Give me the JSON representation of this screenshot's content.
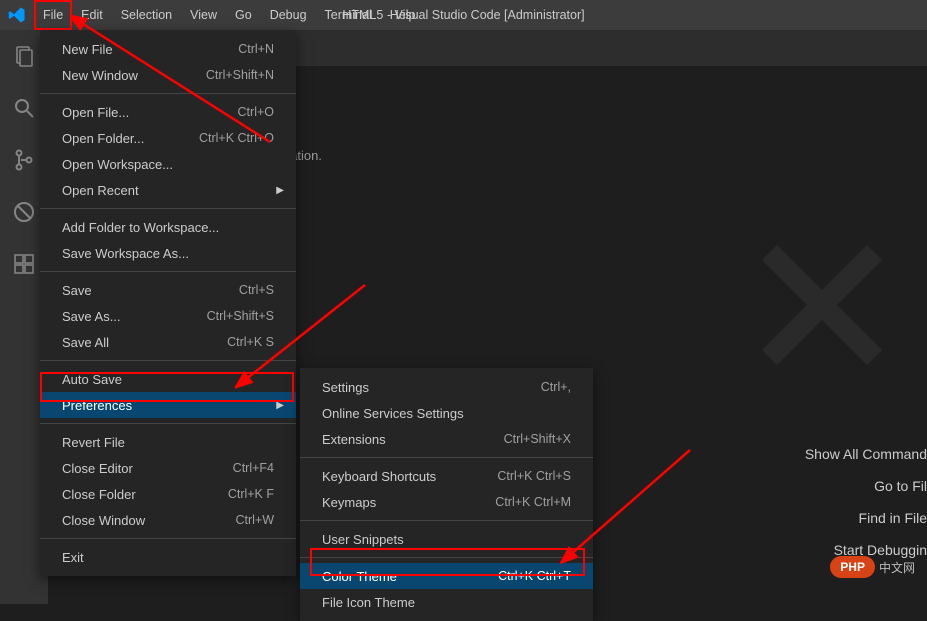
{
  "title": "HTML5 - Visual Studio Code [Administrator]",
  "menubar": [
    "File",
    "Edit",
    "Selection",
    "View",
    "Go",
    "Debug",
    "Terminal",
    "Help"
  ],
  "editor_info": "information.",
  "file_menu": {
    "g1": [
      {
        "label": "New File",
        "shortcut": "Ctrl+N"
      },
      {
        "label": "New Window",
        "shortcut": "Ctrl+Shift+N"
      }
    ],
    "g2": [
      {
        "label": "Open File...",
        "shortcut": "Ctrl+O"
      },
      {
        "label": "Open Folder...",
        "shortcut": "Ctrl+K Ctrl+O"
      },
      {
        "label": "Open Workspace...",
        "shortcut": ""
      },
      {
        "label": "Open Recent",
        "shortcut": "",
        "submenu": true
      }
    ],
    "g3": [
      {
        "label": "Add Folder to Workspace...",
        "shortcut": ""
      },
      {
        "label": "Save Workspace As...",
        "shortcut": ""
      }
    ],
    "g4": [
      {
        "label": "Save",
        "shortcut": "Ctrl+S"
      },
      {
        "label": "Save As...",
        "shortcut": "Ctrl+Shift+S"
      },
      {
        "label": "Save All",
        "shortcut": "Ctrl+K S"
      }
    ],
    "g5": [
      {
        "label": "Auto Save",
        "shortcut": ""
      },
      {
        "label": "Preferences",
        "shortcut": "",
        "submenu": true,
        "hover": true
      }
    ],
    "g6": [
      {
        "label": "Revert File",
        "shortcut": ""
      },
      {
        "label": "Close Editor",
        "shortcut": "Ctrl+F4"
      },
      {
        "label": "Close Folder",
        "shortcut": "Ctrl+K F"
      },
      {
        "label": "Close Window",
        "shortcut": "Ctrl+W"
      }
    ],
    "g7": [
      {
        "label": "Exit",
        "shortcut": ""
      }
    ]
  },
  "pref_menu": {
    "g1": [
      {
        "label": "Settings",
        "shortcut": "Ctrl+,"
      },
      {
        "label": "Online Services Settings",
        "shortcut": ""
      },
      {
        "label": "Extensions",
        "shortcut": "Ctrl+Shift+X"
      }
    ],
    "g2": [
      {
        "label": "Keyboard Shortcuts",
        "shortcut": "Ctrl+K Ctrl+S"
      },
      {
        "label": "Keymaps",
        "shortcut": "Ctrl+K Ctrl+M"
      }
    ],
    "g3": [
      {
        "label": "User Snippets",
        "shortcut": ""
      }
    ],
    "g4": [
      {
        "label": "Color Theme",
        "shortcut": "Ctrl+K Ctrl+T",
        "hover": true
      },
      {
        "label": "File Icon Theme",
        "shortcut": ""
      }
    ]
  },
  "welcome": {
    "l1": "Show All Command",
    "l2": "Go to Fil",
    "l3": "Find in File",
    "l4": "Start Debuggin"
  },
  "badge": {
    "text": "PHP",
    "cn": "中文网"
  },
  "activity_icons": [
    "files-icon",
    "search-icon",
    "source-control-icon",
    "debug-icon",
    "extensions-icon"
  ]
}
